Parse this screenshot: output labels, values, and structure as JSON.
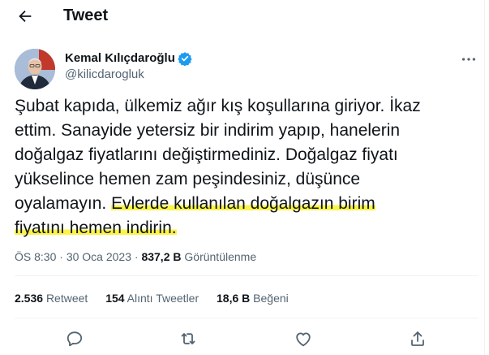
{
  "header": {
    "title": "Tweet"
  },
  "author": {
    "name": "Kemal Kılıçdaroğlu",
    "handle": "@kilicdarogluk"
  },
  "tweet": {
    "lines": [
      "Şubat kapıda, ülkemiz ağır kış koşullarına giriyor. İkaz",
      "ettim. Sanayide yetersiz bir indirim yapıp, hanelerin",
      "doğalgaz fiyatlarını değiştirmediniz. Doğalgaz fiyatı",
      "yükselince hemen zam peşindesiniz, düşünce",
      "oyalamayın. "
    ],
    "highlight_line5": "Evlerde kullanılan doğalgazın birim",
    "highlight_line6": "fiyatını hemen indirin."
  },
  "meta": {
    "time": "ÖS 8:30",
    "sep": "·",
    "date": "30 Oca 2023",
    "views": "837,2 B",
    "views_label": "Görüntülenme"
  },
  "stats": {
    "retweets": "2.536",
    "retweets_label": "Retweet",
    "quotes": "154",
    "quotes_label": "Alıntı Tweetler",
    "likes": "18,6 B",
    "likes_label": "Beğeni"
  },
  "icons": [
    "back-arrow-icon",
    "verified-badge-icon",
    "more-icon",
    "reply-icon",
    "retweet-icon",
    "like-icon",
    "share-icon"
  ],
  "colors": {
    "verified": "#1d9bf0",
    "highlight": "#fbf34a",
    "secondary_text": "#536471"
  }
}
